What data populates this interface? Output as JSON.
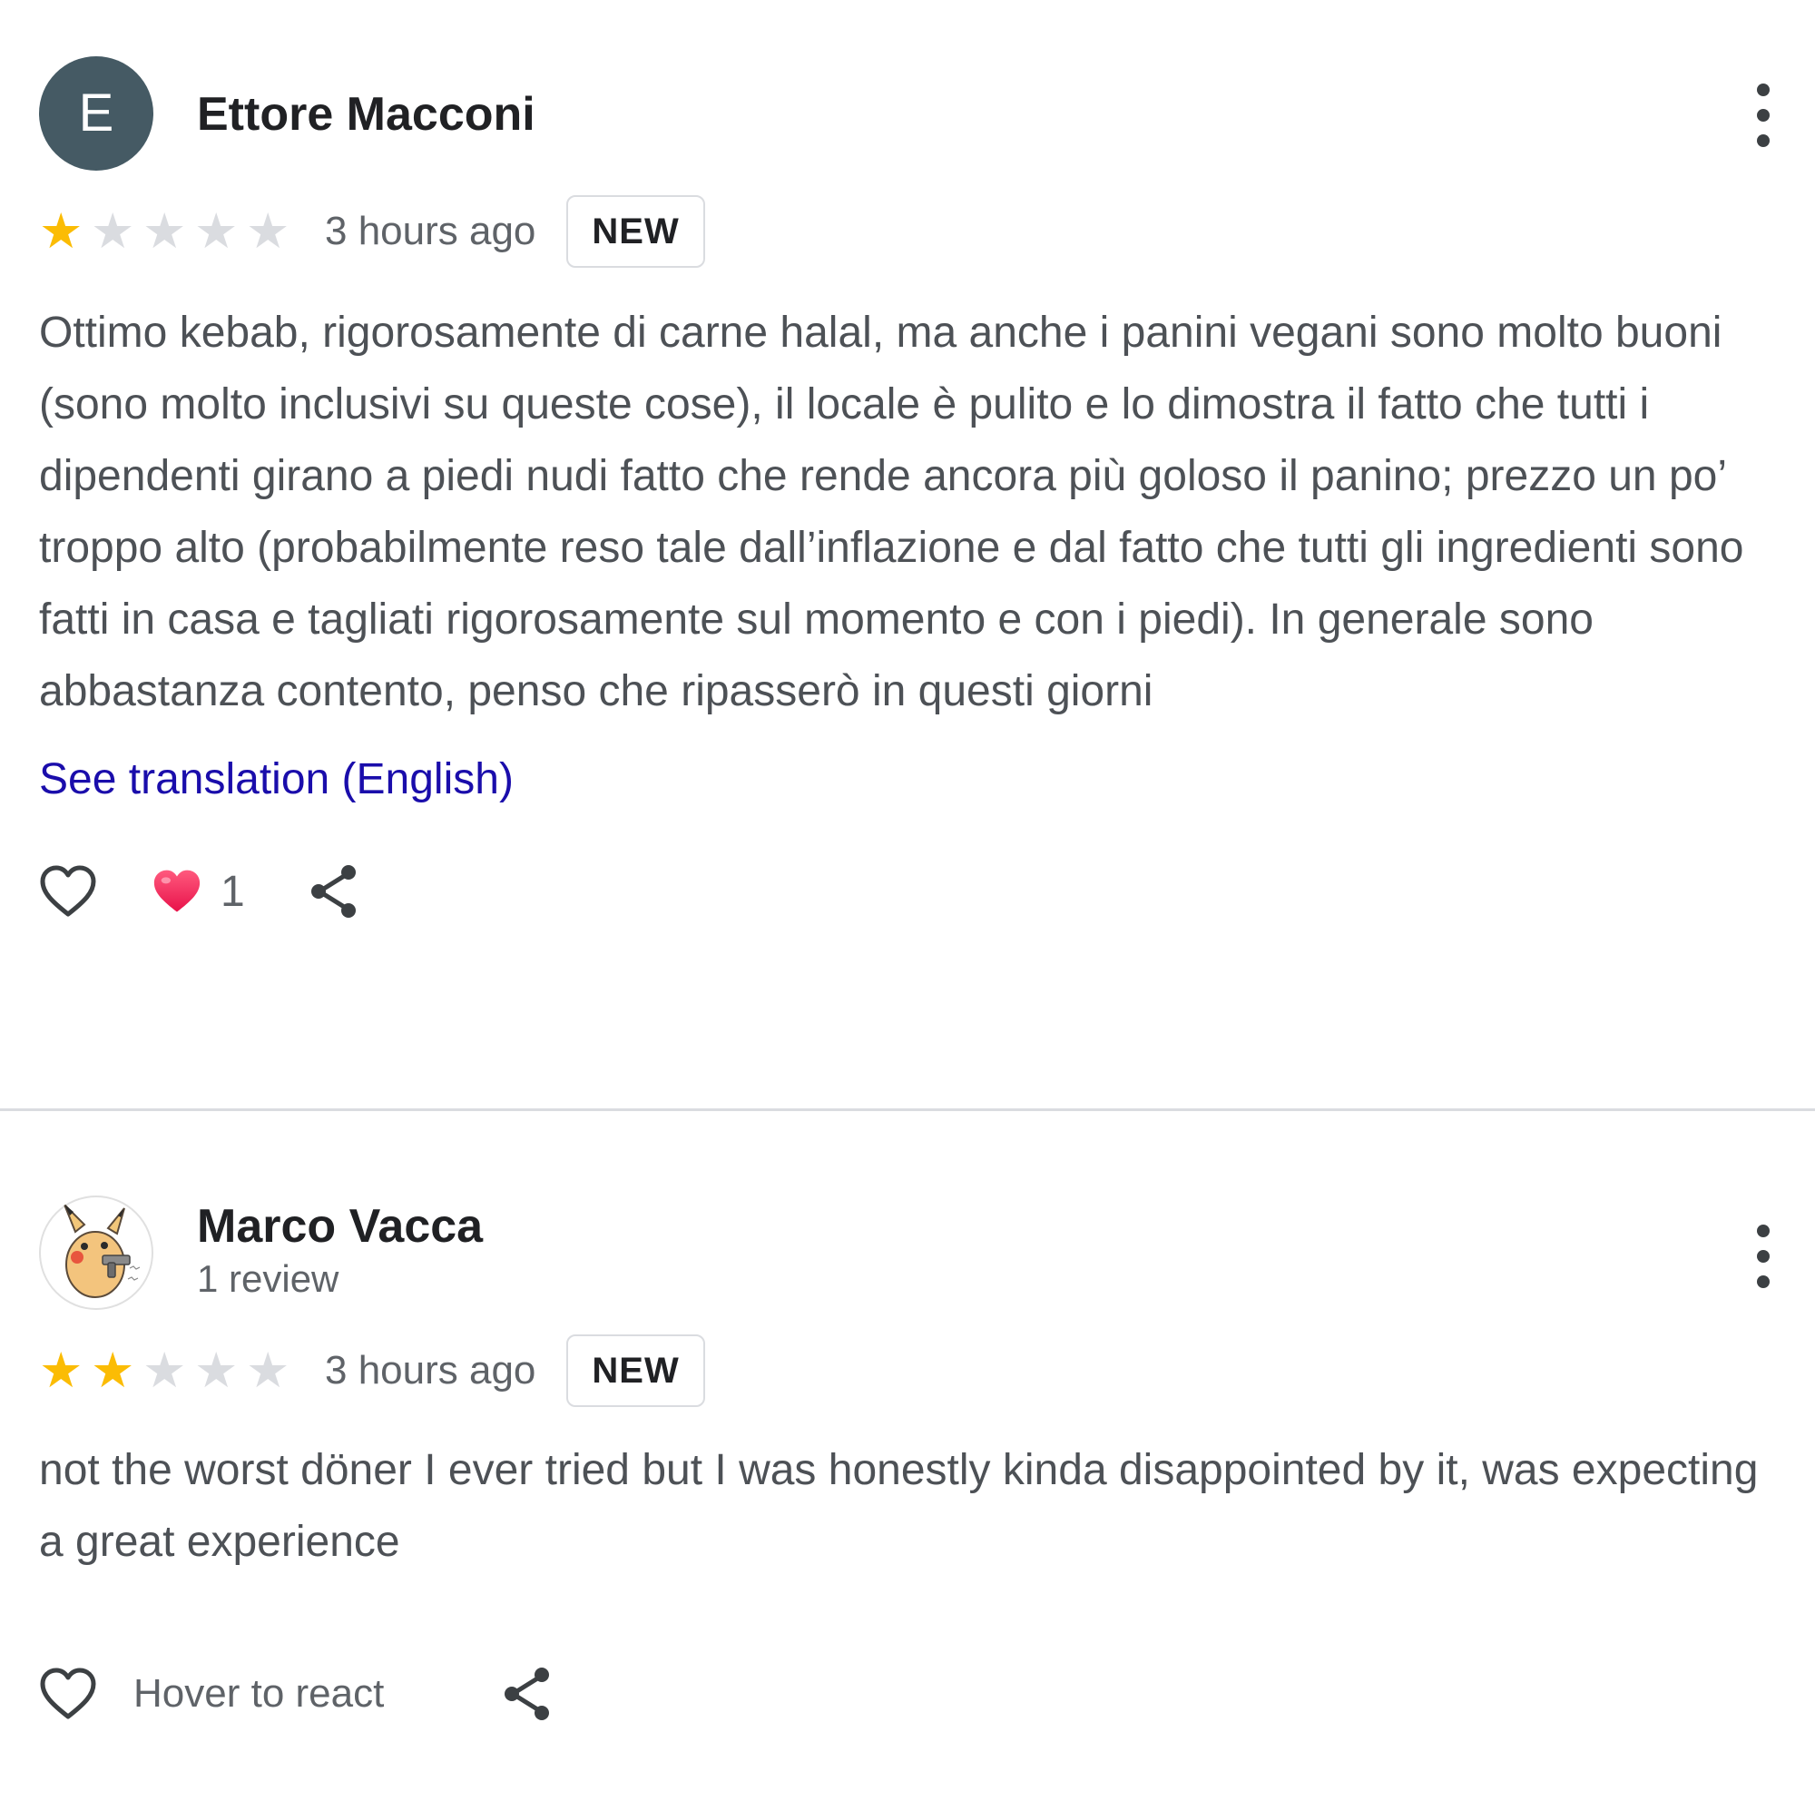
{
  "reviews": [
    {
      "author": "Ettore Macconi",
      "avatar_letter": "E",
      "avatar_color": "#455a64",
      "rating": 1,
      "max_rating": 5,
      "time": "3 hours ago",
      "badge": "NEW",
      "text": "Ottimo kebab, rigorosamente di carne halal, ma anche i panini vegani sono molto buoni (sono molto inclusivi su queste cose), il locale è pulito e lo dimostra il fatto che tutti i dipendenti girano a piedi nudi fatto che rende ancora più goloso il panino; prezzo un po’ troppo alto (probabilmente reso tale dall’inflazione e dal fatto che tutti gli ingredienti sono fatti in casa e tagliati rigorosamente sul momento e con i piedi). In generale sono abbastanza contento, penso che ripasserò in questi giorni",
      "translation_link": "See translation (English)",
      "reaction_count": "1",
      "icons": {
        "like": "heart-outline-icon",
        "reaction": "heart-filled-icon",
        "share": "share-icon",
        "menu": "more-vert-icon"
      }
    },
    {
      "author": "Marco Vacca",
      "author_subtitle": "1 review",
      "avatar_image": "pikachu-avatar",
      "rating": 2,
      "max_rating": 5,
      "time": "3 hours ago",
      "badge": "NEW",
      "text": "not the worst döner I ever tried but I was honestly kinda disappointed by it, was expecting a great experience",
      "hover_label": "Hover to react",
      "icons": {
        "like": "heart-outline-icon",
        "share": "share-icon",
        "menu": "more-vert-icon"
      }
    }
  ],
  "colors": {
    "star_on": "#fbbc04",
    "star_off": "#dadce0",
    "link": "#1a0dab",
    "reaction_heart": "#f8325c"
  }
}
